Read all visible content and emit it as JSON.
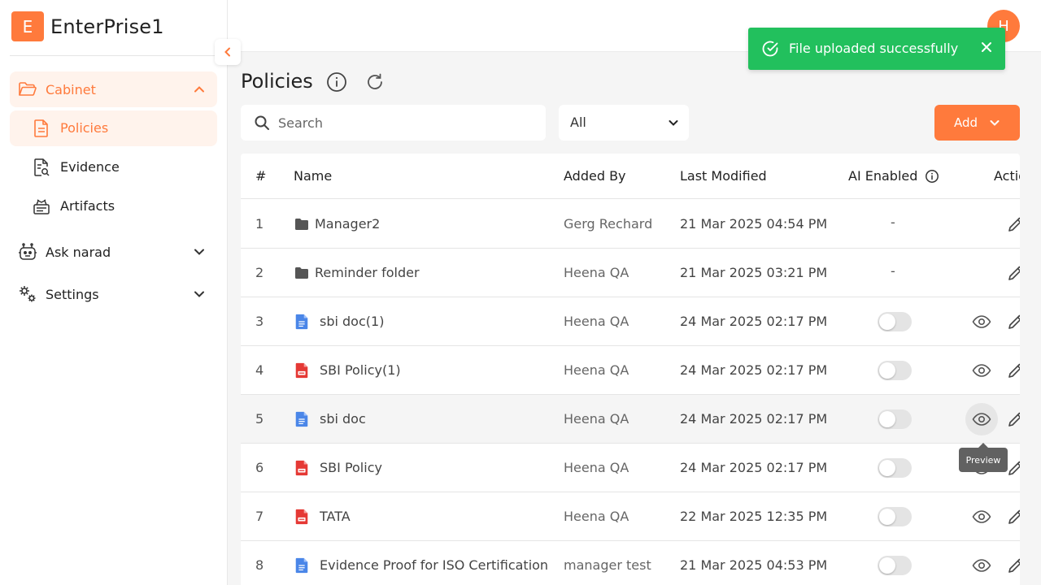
{
  "brand": {
    "logo_letter": "E",
    "name": "EnterPrise1"
  },
  "sidebar": {
    "groups": [
      {
        "label": "Cabinet",
        "icon": "folder-open-icon",
        "expanded": true,
        "items": [
          {
            "label": "Policies",
            "icon": "document-icon",
            "active": true
          },
          {
            "label": "Evidence",
            "icon": "document-search-icon",
            "active": false
          },
          {
            "label": "Artifacts",
            "icon": "artifacts-icon",
            "active": false
          }
        ]
      },
      {
        "label": "Ask narad",
        "icon": "robot-icon",
        "expanded": false
      },
      {
        "label": "Settings",
        "icon": "gears-icon",
        "expanded": false
      }
    ]
  },
  "user": {
    "avatar_letter": "H"
  },
  "toast": {
    "message": "File uploaded successfully"
  },
  "page": {
    "title": "Policies"
  },
  "search": {
    "placeholder": "Search",
    "value": ""
  },
  "filter": {
    "selected": "All"
  },
  "add_button": {
    "label": "Add"
  },
  "table": {
    "headers": [
      "#",
      "Name",
      "Added By",
      "Last Modified",
      "AI Enabled",
      "Actions"
    ],
    "rows": [
      {
        "num": "1",
        "type": "folder",
        "name": "Manager2",
        "added_by": "Gerg Rechard",
        "modified": "21 Mar 2025 04:54 PM",
        "ai": "-"
      },
      {
        "num": "2",
        "type": "folder",
        "name": "Reminder folder",
        "added_by": "Heena QA",
        "modified": "21 Mar 2025 03:21 PM",
        "ai": "-"
      },
      {
        "num": "3",
        "type": "doc",
        "name": "sbi doc(1)",
        "added_by": "Heena QA",
        "modified": "24 Mar 2025 02:17 PM",
        "ai_enabled": false
      },
      {
        "num": "4",
        "type": "pdf",
        "name": "SBI Policy(1)",
        "added_by": "Heena QA",
        "modified": "24 Mar 2025 02:17 PM",
        "ai_enabled": false
      },
      {
        "num": "5",
        "type": "doc",
        "name": "sbi doc",
        "added_by": "Heena QA",
        "modified": "24 Mar 2025 02:17 PM",
        "ai_enabled": false
      },
      {
        "num": "6",
        "type": "pdf",
        "name": "SBI Policy",
        "added_by": "Heena QA",
        "modified": "24 Mar 2025 02:17 PM",
        "ai_enabled": false
      },
      {
        "num": "7",
        "type": "pdf",
        "name": "TATA",
        "added_by": "Heena QA",
        "modified": "22 Mar 2025 12:35 PM",
        "ai_enabled": false
      },
      {
        "num": "8",
        "type": "doc",
        "name": "Evidence Proof for ISO Certification",
        "added_by": "manager test",
        "modified": "21 Mar 2025 04:53 PM",
        "ai_enabled": false
      }
    ]
  },
  "tooltip": {
    "text": "Preview"
  },
  "colors": {
    "accent": "#ff7a3c",
    "accent_bg": "#fff3ec",
    "success": "#22c05d",
    "doc_blue": "#4a86e8",
    "pdf_red": "#e53935"
  }
}
